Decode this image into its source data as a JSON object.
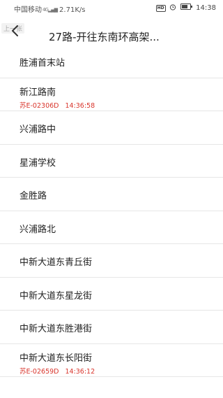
{
  "status_bar": {
    "carrier": "中国移动",
    "network_tag": "4G",
    "speed": "2.71K/s",
    "hd_label": "HD",
    "battery_level": 0.7,
    "time": "14:38"
  },
  "header": {
    "back_hint": "上一张",
    "title": "27路-开往东南环高架..."
  },
  "stops": [
    {
      "name": "胜浦首末站"
    },
    {
      "name": "新江路南",
      "bus_plate": "苏E-02306D",
      "bus_time": "14:36:58"
    },
    {
      "name": "兴浦路中"
    },
    {
      "name": "星浦学校"
    },
    {
      "name": "金胜路"
    },
    {
      "name": "兴浦路北"
    },
    {
      "name": "中新大道东青丘街"
    },
    {
      "name": "中新大道东星龙街"
    },
    {
      "name": "中新大道东胜港街"
    },
    {
      "name": "中新大道东长阳街",
      "bus_plate": "苏E-02659D",
      "bus_time": "14:36:12"
    }
  ],
  "colors": {
    "bus_info": "#d9342b",
    "divider": "#e6e6e6",
    "text": "#222222"
  },
  "icons": {
    "back": "arrow-left-icon",
    "alarm": "alarm-clock-icon",
    "battery": "battery-icon",
    "signal": "signal-bars-icon"
  }
}
